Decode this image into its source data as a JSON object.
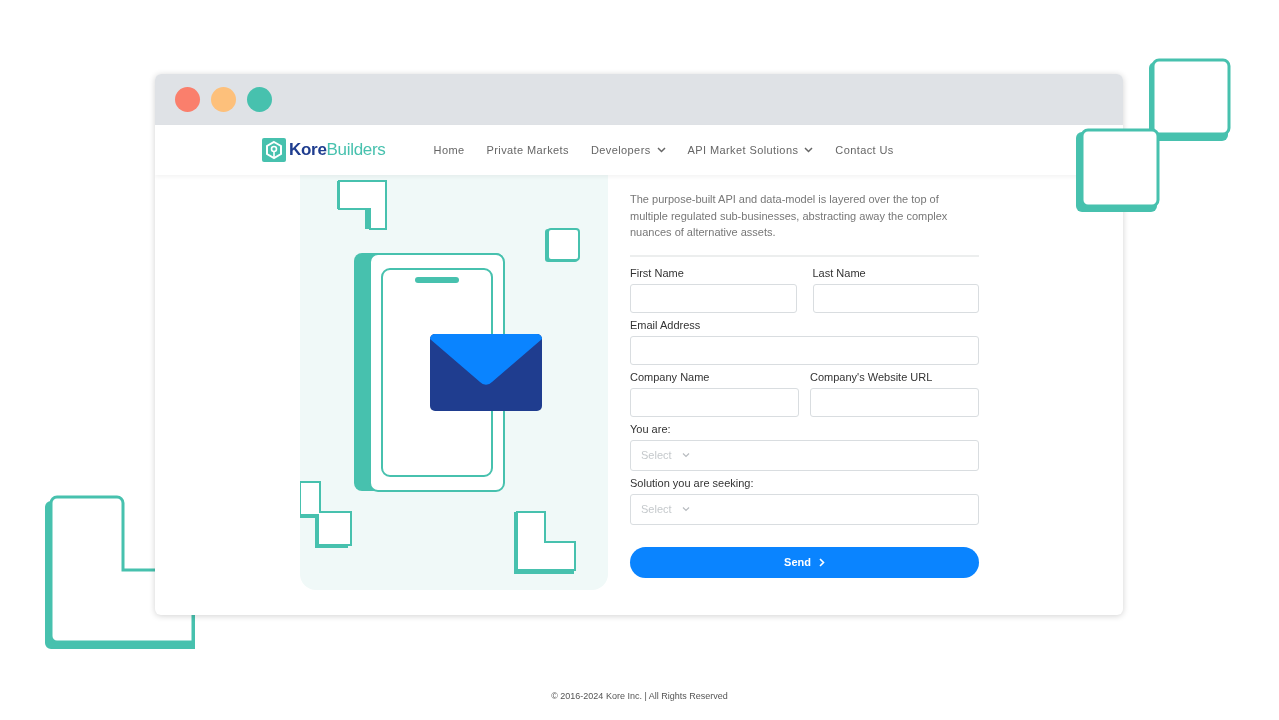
{
  "window": {
    "controls": [
      {
        "color": "#fa7f6c"
      },
      {
        "color": "#fdc07b"
      },
      {
        "color": "#47c1ae"
      }
    ]
  },
  "nav": {
    "logo": {
      "first": "Kore",
      "second": "Builders"
    },
    "items": [
      {
        "label": "Home",
        "has_menu": false
      },
      {
        "label": "Private Markets",
        "has_menu": false
      },
      {
        "label": "Developers",
        "has_menu": true
      },
      {
        "label": "API Market Solutions",
        "has_menu": true
      },
      {
        "label": "Contact Us",
        "has_menu": false
      }
    ]
  },
  "form": {
    "intro": "The purpose-built API and data-model is layered over the top of multiple regulated sub-businesses, abstracting away the complex nuances of alternative assets.",
    "rows": [
      [
        {
          "label": "First Name",
          "kind": "text"
        },
        {
          "label": "Last Name",
          "kind": "text"
        }
      ],
      [
        {
          "label": "Email Address",
          "kind": "text"
        }
      ],
      [
        {
          "label": "Company Name",
          "kind": "text"
        },
        {
          "label": "Company's Website URL",
          "kind": "text"
        }
      ],
      [
        {
          "label": "You are:",
          "kind": "select",
          "placeholder": "Select"
        }
      ],
      [
        {
          "label": "Solution you are seeking:",
          "kind": "select",
          "placeholder": "Select"
        }
      ]
    ],
    "submit": "Send"
  },
  "footer": "© 2016-2024 Kore Inc. | All Rights Reserved"
}
